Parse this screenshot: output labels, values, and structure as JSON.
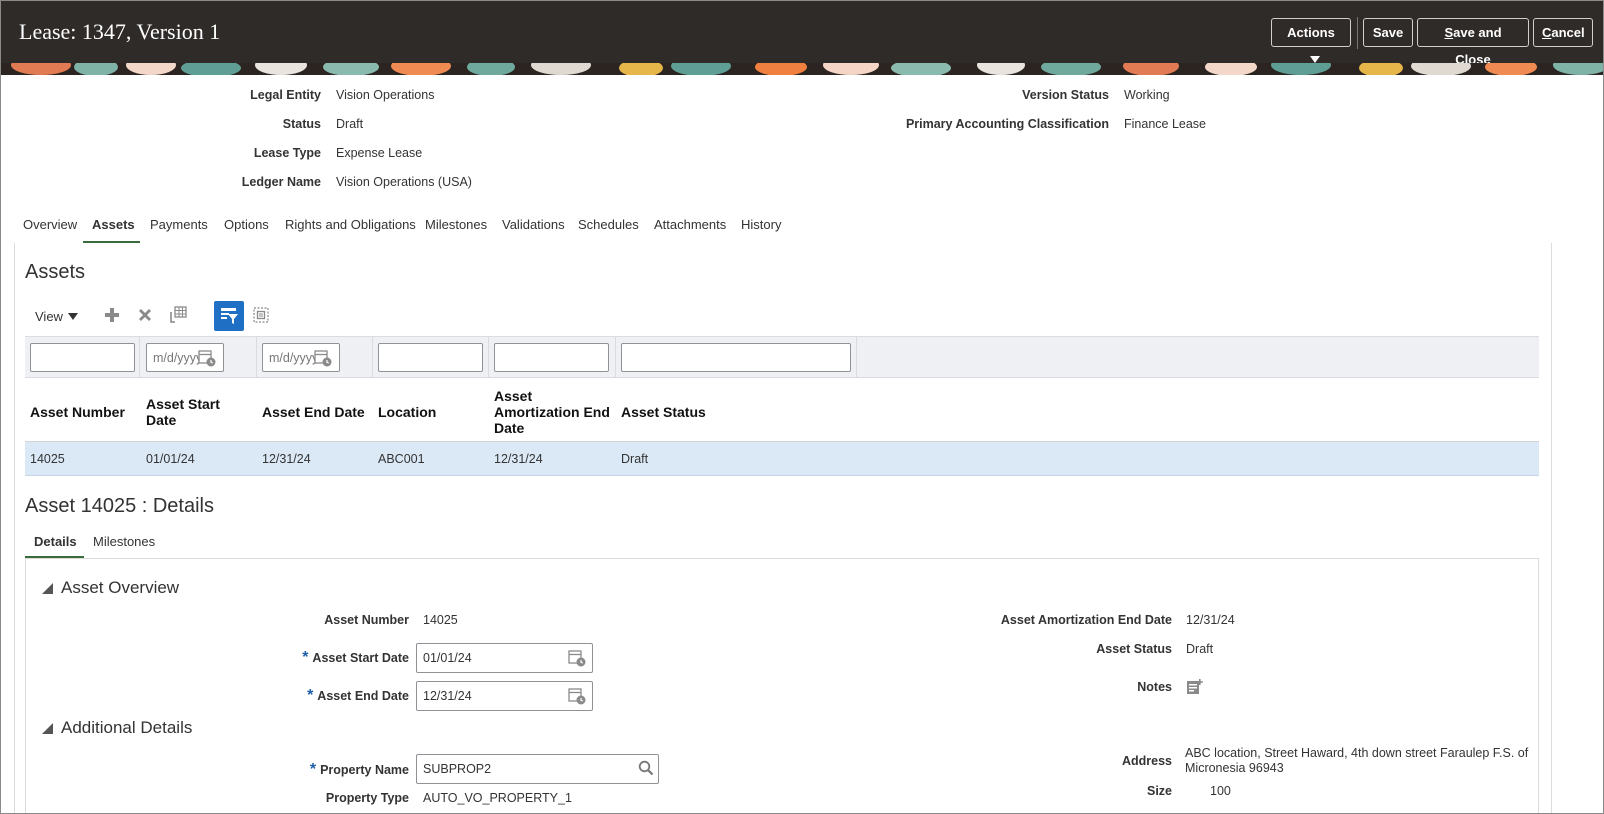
{
  "header": {
    "title": "Lease: 1347, Version 1",
    "actions_label": "Actions",
    "save_label": "Save",
    "save_close_prefix": "",
    "save_close_underlined": "S",
    "save_close_rest": "ave and Close",
    "cancel_underlined": "C",
    "cancel_rest": "ancel"
  },
  "lease_fields": {
    "legal_entity_label": "Legal Entity",
    "legal_entity_value": "Vision Operations",
    "status_label": "Status",
    "status_value": "Draft",
    "lease_type_label": "Lease Type",
    "lease_type_value": "Expense Lease",
    "ledger_name_label": "Ledger Name",
    "ledger_name_value": "Vision Operations (USA)",
    "version_status_label": "Version Status",
    "version_status_value": "Working",
    "pac_label": "Primary Accounting Classification",
    "pac_value": "Finance Lease"
  },
  "tabs": [
    "Overview",
    "Assets",
    "Payments",
    "Options",
    "Rights and Obligations",
    "Milestones",
    "Validations",
    "Schedules",
    "Attachments",
    "History"
  ],
  "assets": {
    "title": "Assets",
    "view_label": "View",
    "date_placeholder": "m/d/yyyy",
    "columns": {
      "asset_number": "Asset Number",
      "start_date_1": "Asset Start",
      "start_date_2": "Date",
      "end_date": "Asset End Date",
      "location": "Location",
      "amort_1": "Asset",
      "amort_2": "Amortization End",
      "amort_3": "Date",
      "status": "Asset Status"
    },
    "row": {
      "asset_number": "14025",
      "start_date": "01/01/24",
      "end_date": "12/31/24",
      "location": "ABC001",
      "amort_end_date": "12/31/24",
      "status": "Draft"
    }
  },
  "details": {
    "title": "Asset 14025 : Details",
    "tabs": [
      "Details",
      "Milestones"
    ],
    "overview_title": "Asset Overview",
    "asset_number_label": "Asset Number",
    "asset_number_value": "14025",
    "start_date_label": "Asset Start Date",
    "start_date_value": "01/01/24",
    "end_date_label": "Asset End Date",
    "end_date_value": "12/31/24",
    "amort_label": "Asset Amortization End Date",
    "amort_value": "12/31/24",
    "status_label": "Asset Status",
    "status_value": "Draft",
    "notes_label": "Notes",
    "additional_title": "Additional Details",
    "property_name_label": "Property Name",
    "property_name_value": "SUBPROP2",
    "property_type_label": "Property Type",
    "property_type_value": "AUTO_VO_PROPERTY_1",
    "address_label": "Address",
    "address_line1": "ABC location, Street Haward, 4th down street Faraulep F.S. of",
    "address_line2": "Micronesia 96943",
    "size_label": "Size",
    "size_value": "100",
    "required_mark": "*"
  },
  "colors": {
    "header_bg": "#2f2b29",
    "selected_row": "#dbe9f7",
    "accent_tab": "#3a6b3a",
    "toolbar_selected": "#1f6fc5",
    "required": "#1f5ea8"
  }
}
